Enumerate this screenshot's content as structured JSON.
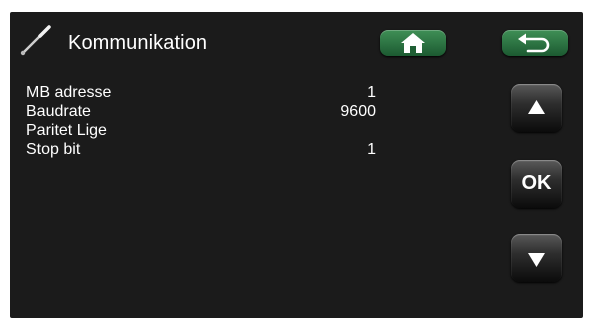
{
  "header": {
    "title": "Kommunikation",
    "icon": "screwdriver-icon",
    "home_icon": "home-icon",
    "back_icon": "back-arrow-icon"
  },
  "settings": [
    {
      "label": "MB adresse",
      "value": "1"
    },
    {
      "label": "Baudrate",
      "value": "9600"
    },
    {
      "label": "Paritet Lige",
      "value": ""
    },
    {
      "label": "Stop bit",
      "value": "1"
    }
  ],
  "nav": {
    "up_icon": "triangle-up-icon",
    "ok_label": "OK",
    "down_icon": "triangle-down-icon"
  },
  "colors": {
    "background": "#1b1b1b",
    "accent_green": "#2e7a45",
    "text": "#ffffff"
  }
}
